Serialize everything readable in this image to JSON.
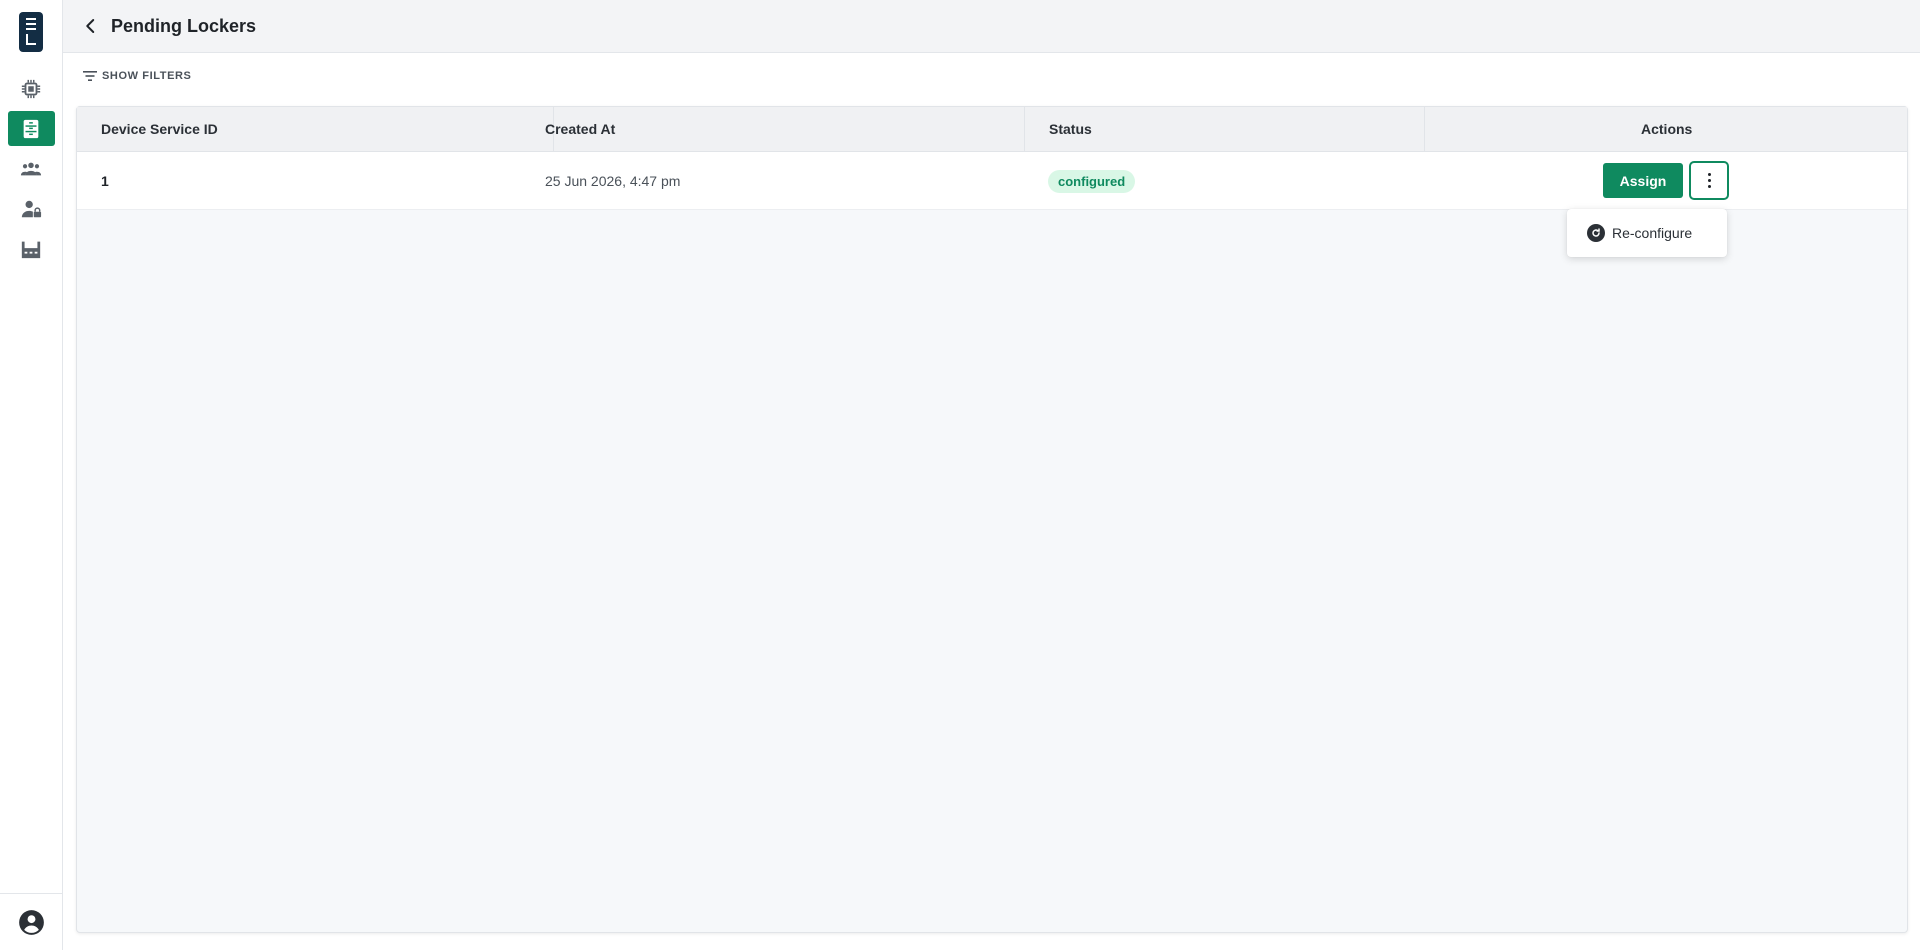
{
  "app": {
    "logo_icon": "locker-logo-icon"
  },
  "sidebar": {
    "items": [
      {
        "icon": "chip-icon",
        "active": false
      },
      {
        "icon": "locker-icon",
        "active": true
      },
      {
        "icon": "users-icon",
        "active": false
      },
      {
        "icon": "user-lock-icon",
        "active": false
      },
      {
        "icon": "factory-icon",
        "active": false
      }
    ],
    "profile_icon": "account-circle-icon"
  },
  "header": {
    "title": "Pending Lockers",
    "back_icon": "chevron-left-icon"
  },
  "filters": {
    "label": "SHOW FILTERS",
    "icon": "filter-icon"
  },
  "table": {
    "columns": [
      "Device Service ID",
      "Created At",
      "Status",
      "Actions"
    ],
    "rows": [
      {
        "device_service_id": "1",
        "created_at": "25 Jun 2026, 4:47 pm",
        "status": "configured",
        "assign_label": "Assign"
      }
    ]
  },
  "menu": {
    "items": [
      {
        "label": "Re-configure",
        "icon": "refresh-icon"
      }
    ]
  },
  "colors": {
    "accent": "#0f8a5f",
    "status_bg": "#d9f7e6",
    "logo": "#132d44"
  }
}
